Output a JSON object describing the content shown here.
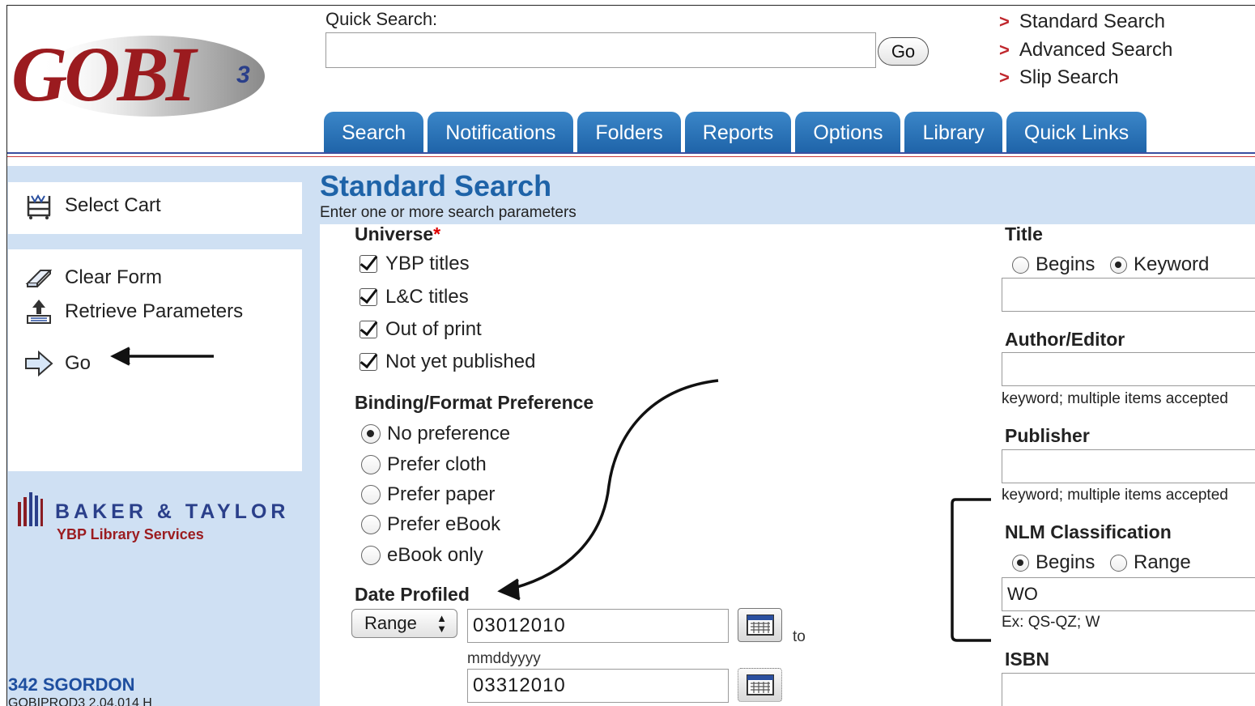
{
  "header": {
    "logo_text": "GOBI",
    "logo_version": "3",
    "quick_search": {
      "label": "Quick Search:",
      "value": "",
      "go_label": "Go"
    },
    "search_links": [
      {
        "chevron": ">",
        "label": "Standard Search"
      },
      {
        "chevron": ">",
        "label": "Advanced Search"
      },
      {
        "chevron": ">",
        "label": "Slip Search"
      }
    ],
    "tabs": [
      "Search",
      "Notifications",
      "Folders",
      "Reports",
      "Options",
      "Library",
      "Quick Links"
    ]
  },
  "sidebar": {
    "select_cart": {
      "label": "Select Cart",
      "icon": "cart-icon"
    },
    "actions": [
      {
        "label": "Clear Form",
        "icon": "eraser-icon"
      },
      {
        "label": "Retrieve Parameters",
        "icon": "retrieve-icon"
      },
      {
        "label": "Go",
        "icon": "arrow-right-icon"
      }
    ],
    "partner_logo": {
      "brand": "BAKER & TAYLOR",
      "sub": "YBP Library Services"
    },
    "user": "342 SGORDON",
    "build": "GOBIPROD3 2.04.014 H"
  },
  "main": {
    "title": "Standard Search",
    "subtitle": "Enter one or more search parameters",
    "universe": {
      "label": "Universe",
      "required_mark": "*",
      "options": [
        {
          "label": "YBP titles",
          "checked": true
        },
        {
          "label": "L&C titles",
          "checked": true
        },
        {
          "label": "Out of print",
          "checked": true
        },
        {
          "label": "Not yet published",
          "checked": true
        }
      ]
    },
    "binding": {
      "label": "Binding/Format Preference",
      "options": [
        {
          "label": "No preference",
          "selected": true
        },
        {
          "label": "Prefer cloth",
          "selected": false
        },
        {
          "label": "Prefer paper",
          "selected": false
        },
        {
          "label": "Prefer eBook",
          "selected": false
        },
        {
          "label": "eBook only",
          "selected": false
        }
      ]
    },
    "date_profiled": {
      "label": "Date Profiled",
      "mode": "Range",
      "from": "03012010",
      "format_hint": "mmddyyyy",
      "to_label": "to",
      "to": "03312010"
    },
    "title_field": {
      "label": "Title",
      "modes": [
        {
          "label": "Begins",
          "selected": false
        },
        {
          "label": "Keyword",
          "selected": true
        }
      ],
      "value": ""
    },
    "author": {
      "label": "Author/Editor",
      "value": "",
      "hint": "keyword; multiple items accepted"
    },
    "publisher": {
      "label": "Publisher",
      "value": "",
      "hint": "keyword; multiple items accepted"
    },
    "nlm": {
      "label": "NLM Classification",
      "modes": [
        {
          "label": "Begins",
          "selected": true
        },
        {
          "label": "Range",
          "selected": false
        }
      ],
      "value": "WO",
      "hint": "Ex: QS-QZ; W"
    },
    "isbn": {
      "label": "ISBN",
      "value": ""
    }
  },
  "colors": {
    "tab_blue": "#1e63a8",
    "panel_blue": "#cfe0f3",
    "link_chevron": "#c0272d",
    "logo_red": "#9b1b1f",
    "required": "#dd0000"
  }
}
